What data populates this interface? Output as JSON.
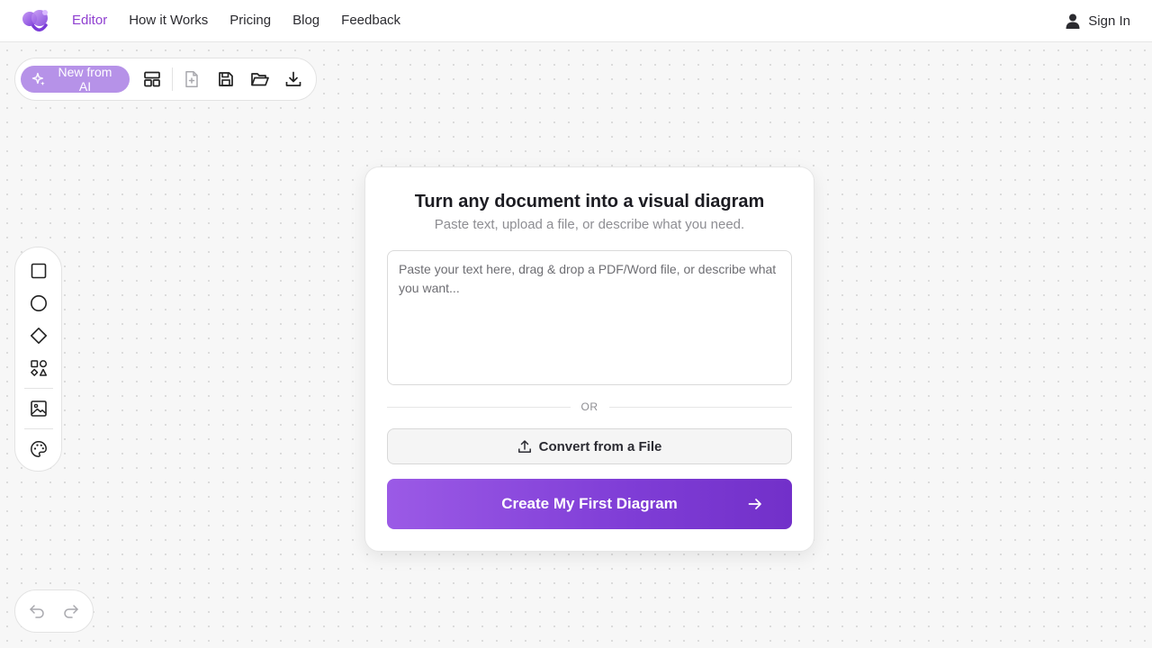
{
  "nav": {
    "logo_icon": "app-logo",
    "links": [
      {
        "label": "Editor",
        "active": true
      },
      {
        "label": "How it Works",
        "active": false
      },
      {
        "label": "Pricing",
        "active": false
      },
      {
        "label": "Blog",
        "active": false
      },
      {
        "label": "Feedback",
        "active": false
      }
    ],
    "sign_in_label": "Sign In",
    "sign_in_icon": "user-icon"
  },
  "toolbar": {
    "ai_button_label": "New from AI",
    "ai_button_icon": "sparkles-icon",
    "buttons": [
      "layout-template-icon",
      "new-file-icon",
      "save-icon",
      "open-folder-icon",
      "download-icon"
    ]
  },
  "shapes": {
    "tools": [
      "square-icon",
      "circle-icon",
      "diamond-icon",
      "shapes-icon",
      "image-icon",
      "palette-icon"
    ]
  },
  "history": {
    "undo_icon": "undo-icon",
    "redo_icon": "redo-icon"
  },
  "card": {
    "title": "Turn any document into a visual diagram",
    "subtitle": "Paste text, upload a file, or describe what you need.",
    "prompt_placeholder": "Paste your text here, drag & drop a PDF/Word file, or describe what you want...",
    "prompt_value": "",
    "or_label": "OR",
    "convert_label": "Convert from a File",
    "convert_icon": "upload-icon",
    "create_label": "Create My First Diagram",
    "create_icon": "arrow-right-icon"
  },
  "colors": {
    "accent": "#8f3fd0",
    "ai_button": "#b692e8",
    "create_gradient_start": "#9b5ae6",
    "create_gradient_end": "#7230c9"
  }
}
